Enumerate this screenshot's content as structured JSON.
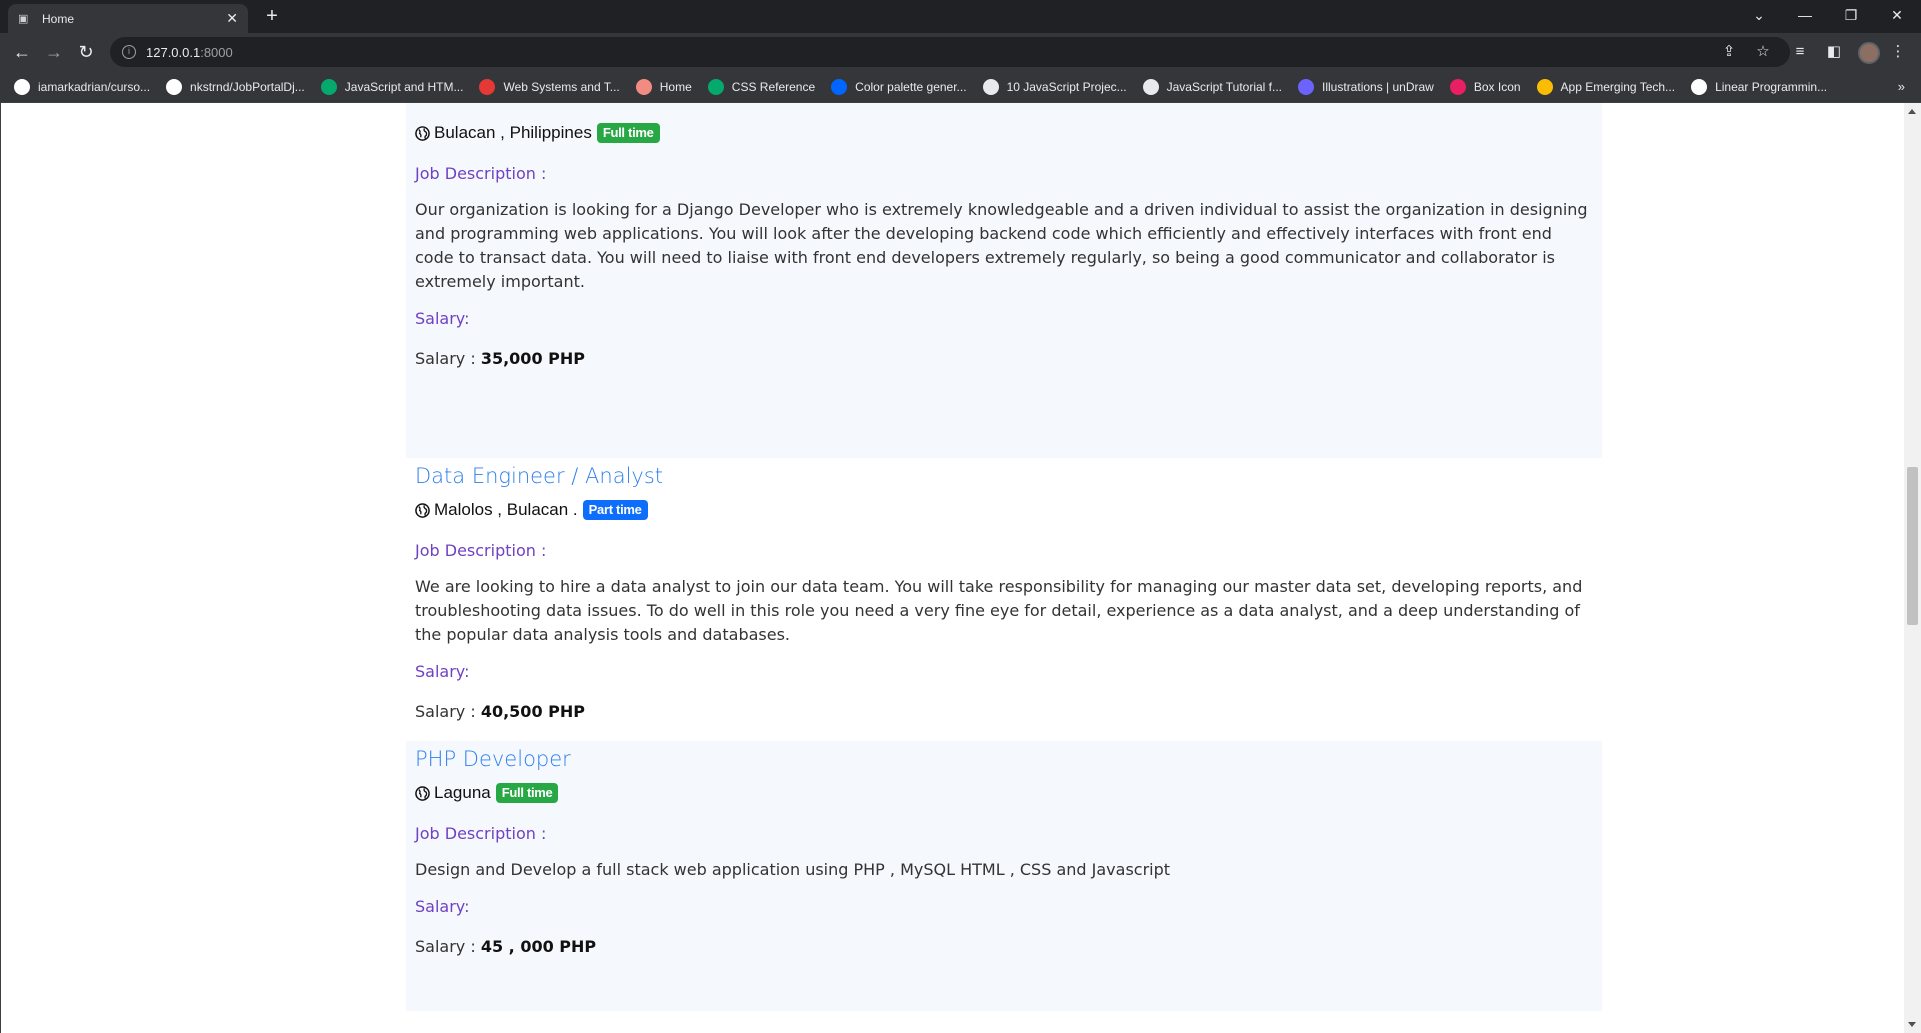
{
  "browser": {
    "tab_title": "Home",
    "url_host": "127.0.0.1",
    "url_port": ":8000",
    "bookmarks": [
      {
        "label": "iamarkadrian/curso...",
        "icon": "github-icon",
        "color": "#ffffff"
      },
      {
        "label": "nkstrnd/JobPortalDj...",
        "icon": "github-icon",
        "color": "#ffffff"
      },
      {
        "label": "JavaScript and HTM...",
        "icon": "w3schools-icon",
        "color": "#04aa6d"
      },
      {
        "label": "Web Systems and T...",
        "icon": "circle-icon",
        "color": "#e53935"
      },
      {
        "label": "Home",
        "icon": "site-icon",
        "color": "#f28b82"
      },
      {
        "label": "CSS Reference",
        "icon": "w3schools-icon",
        "color": "#04aa6d"
      },
      {
        "label": "Color palette gener...",
        "icon": "coolors-icon",
        "color": "#0066ff"
      },
      {
        "label": "10 JavaScript Projec...",
        "icon": "gear-icon",
        "color": "#e8eaed"
      },
      {
        "label": "JavaScript Tutorial f...",
        "icon": "gear-icon",
        "color": "#e8eaed"
      },
      {
        "label": "Illustrations | unDraw",
        "icon": "undraw-icon",
        "color": "#6c63ff"
      },
      {
        "label": "Box Icon",
        "icon": "boxicons-icon",
        "color": "#e91e63"
      },
      {
        "label": "App Emerging Tech...",
        "icon": "drive-icon",
        "color": "#fbbc04"
      },
      {
        "label": "Linear Programmin...",
        "icon": "doc-icon",
        "color": "#ffffff"
      }
    ]
  },
  "jobs": [
    {
      "title": "",
      "location": "Bulacan , Philippines",
      "type": "Full time",
      "desc_label": "Job Description :",
      "description": "Our organization is looking for a Django Developer who is extremely knowledgeable and a driven individual to assist the organization in designing and programming web applications. You will look after the developing backend code which efficiently and effectively interfaces with front end code to transact data. You will need to liaise with front end developers extremely regularly, so being a good communicator and collaborator is extremely important.",
      "salary_label": "Salary:",
      "salary_prefix": "Salary :",
      "salary_value": "35,000 PHP"
    },
    {
      "title": "Data Engineer / Analyst",
      "location": "Malolos , Bulacan .",
      "type": "Part time",
      "desc_label": "Job Description :",
      "description": "We are looking to hire a data analyst to join our data team. You will take responsibility for managing our master data set, developing reports, and troubleshooting data issues. To do well in this role you need a very fine eye for detail, experience as a data analyst, and a deep understanding of the popular data analysis tools and databases.",
      "salary_label": "Salary:",
      "salary_prefix": "Salary :",
      "salary_value": "40,500 PHP"
    },
    {
      "title": "PHP Developer",
      "location": "Laguna",
      "type": "Full time",
      "desc_label": "Job Description :",
      "description": "Design and Develop a full stack web application using PHP , MySQL HTML , CSS and Javascript",
      "salary_label": "Salary:",
      "salary_prefix": "Salary :",
      "salary_value": "45 , 000 PHP"
    }
  ]
}
